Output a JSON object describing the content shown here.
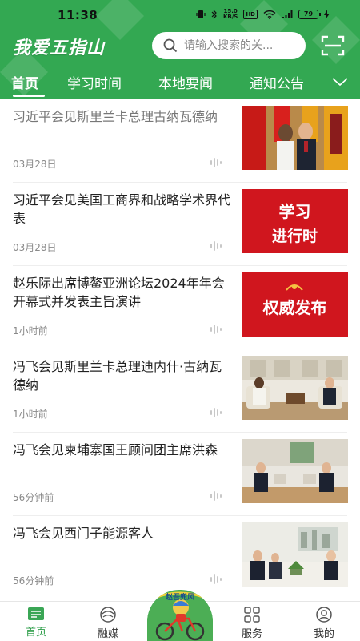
{
  "status_bar": {
    "time": "11:38",
    "net_speed_value": "15.0",
    "net_speed_unit": "KB/S",
    "hd": "HD",
    "battery": "79"
  },
  "header": {
    "app_title": "我爱五指山",
    "search_placeholder": "请输入搜索的关...",
    "tabs": [
      {
        "label": "首页",
        "active": true
      },
      {
        "label": "学习时间",
        "active": false
      },
      {
        "label": "本地要闻",
        "active": false
      },
      {
        "label": "通知公告",
        "active": false
      }
    ]
  },
  "news": [
    {
      "title": "习近平会见斯里兰卡总理古纳瓦德纳",
      "time": "03月28日",
      "read": true,
      "thumb": "photo-flags"
    },
    {
      "title": "习近平会见美国工商界和战略学术界代表",
      "time": "03月28日",
      "read": false,
      "thumb": "banner",
      "banner_text": [
        "学习",
        "进行时"
      ]
    },
    {
      "title": "赵乐际出席博鳌亚洲论坛2024年年会开幕式并发表主旨演讲",
      "time": "1小时前",
      "read": false,
      "thumb": "banner",
      "banner_text": [
        "权威发布"
      ]
    },
    {
      "title": "冯飞会见斯里兰卡总理迪内什·古纳瓦德纳",
      "time": "1小时前",
      "read": false,
      "thumb": "photo-meeting"
    },
    {
      "title": "冯飞会见柬埔寨国王顾问团主席洪森",
      "time": "56分钟前",
      "read": false,
      "thumb": "photo-meeting"
    },
    {
      "title": "冯飞会见西门子能源客人",
      "time": "56分钟前",
      "read": false,
      "thumb": "photo-meeting"
    }
  ],
  "bottom_nav": {
    "items": [
      {
        "label": "首页",
        "icon": "home-icon",
        "active": true
      },
      {
        "label": "融媒",
        "icon": "media-icon",
        "active": false
      },
      {
        "label": "服务",
        "icon": "services-icon",
        "active": false
      },
      {
        "label": "我的",
        "icon": "profile-icon",
        "active": false
      }
    ],
    "center_badge_text": "赵吾兜风"
  },
  "colors": {
    "brand_green": "#33a852",
    "banner_red": "#d0161e"
  }
}
